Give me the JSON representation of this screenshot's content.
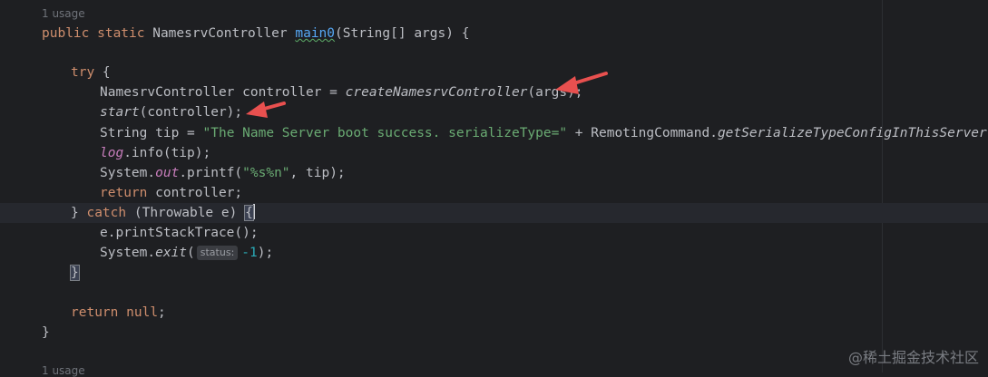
{
  "editor": {
    "usage_top": "1 usage",
    "usage_bottom": "1 usage",
    "method_mod": "public static ",
    "method_type": "NamesrvController ",
    "method_name": "main0",
    "method_params": "(String[] args) {",
    "try_kw": "try",
    "try_rest": " {",
    "l_create_a": "NamesrvController controller = ",
    "l_create_fn": "createNamesrvController",
    "l_create_b": "(args);",
    "l_start_fn": "start",
    "l_start_b": "(controller);",
    "l_tip_a": "String tip = ",
    "l_tip_str": "\"The Name Server boot success. serializeType=\"",
    "l_tip_b": " + RemotingCommand.",
    "l_tip_fn": "getSerializeTypeConfigInThisServer",
    "l_tip_c": "();",
    "l_log_field": "log",
    "l_log_b": ".info(tip);",
    "l_printf_a": "System.",
    "l_printf_field": "out",
    "l_printf_b": ".printf(",
    "l_printf_str": "\"%s%n\"",
    "l_printf_c": ", tip);",
    "return_kw": "return",
    "return_rest": " controller;",
    "catch_a": "} ",
    "catch_kw": "catch",
    "catch_b": " (Throwable e) ",
    "catch_brace": "{",
    "l_trace": "e.printStackTrace();",
    "l_exit_a": "System.",
    "l_exit_fn": "exit",
    "l_exit_b": "(",
    "exit_inlay": "status:",
    "exit_num": "-1",
    "l_exit_c": ");",
    "close_catch": "}",
    "ret_null_kw": "return",
    "ret_null_sp": " ",
    "ret_null_val": "null",
    "ret_null_semi": ";",
    "close_method": "}"
  },
  "watermark": "@稀土掘金技术社区",
  "colors": {
    "background": "#1e1f22",
    "keyword": "#cf8e6d",
    "string": "#6aab73",
    "method_decl": "#56a8f5",
    "field": "#c77dbb",
    "number": "#2aacb8",
    "annotation_arrow": "#e8504f"
  }
}
